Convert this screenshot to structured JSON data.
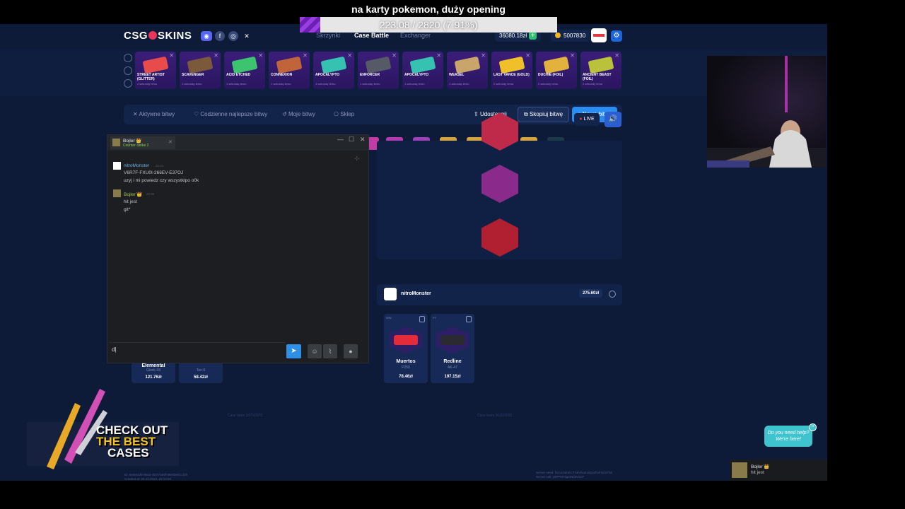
{
  "overlay": {
    "title": "na karty pokemon, duży opening",
    "progress_text": "223.08 / 2820 (7.91%)",
    "progress_fraction": 0.0791
  },
  "header": {
    "logo": "CSG⬤SKINS",
    "nav": [
      "Skrzynki",
      "Case Battle",
      "Exchanger"
    ],
    "balance": "36080.18zł",
    "coins": "5007830"
  },
  "drops": [
    {
      "name": "STREET ARTIST (GLITTER)",
      "sub": "2 sekundy temu",
      "color": "#e84b4b"
    },
    {
      "name": "SCAVENGER",
      "sub": "1 sekundę temu",
      "color": "#7a5a3a"
    },
    {
      "name": "ACID ETCHED",
      "sub": "1 sekundę temu",
      "color": "#3dc46e"
    },
    {
      "name": "CONNEXION",
      "sub": "1 sekundę temu",
      "color": "#c0653a"
    },
    {
      "name": "APOCALYPTO",
      "sub": "1 sekundę temu",
      "color": "#35c2b0"
    },
    {
      "name": "ENFORCER",
      "sub": "1 sekundę temu",
      "color": "#555a66"
    },
    {
      "name": "APOCALYPTO",
      "sub": "1 sekundę temu",
      "color": "#35c2b0"
    },
    {
      "name": "WEASEL",
      "sub": "1 sekundę temu",
      "color": "#c9a56b"
    },
    {
      "name": "LAST VANCE (GOLD)",
      "sub": "2 sekundy temu",
      "color": "#f0c028"
    },
    {
      "name": "DUCHIE (FOIL)",
      "sub": "2 sekundy temu",
      "color": "#e3b23c"
    },
    {
      "name": "ANCIENT BEAST (FOIL)",
      "sub": "2 sekundy temu",
      "color": "#b9c23a"
    }
  ],
  "toolbar": {
    "tabs": [
      "Aktywne bitwy",
      "Codzienne najlepsze bitwy",
      "Moje bitwy",
      "Sklep"
    ],
    "share": "Udostępnij",
    "copy": "Skopiuj bitwę",
    "new": "Nowa bitwa"
  },
  "battle": {
    "live": "LIVE",
    "player_name": "nitroMonster",
    "player_value": "275.60zł",
    "items": [
      {
        "wear": "WW",
        "name": "Muertos",
        "sub": "P250",
        "price": "78.46zł",
        "color": "#e32b3a"
      },
      {
        "wear": "FT",
        "name": "Redline",
        "sub": "AK-47",
        "price": "197.15zł",
        "color": "#2a2a30"
      }
    ],
    "left_items": [
      {
        "name": "Elemental",
        "sub": "Glock-18",
        "price": "121.76zł"
      },
      {
        "name": "",
        "sub": "Tec-9",
        "price": "58.42zł"
      }
    ],
    "footer_left": "Case team 2970/2970",
    "footer_right": "Case team 3025/3026",
    "id_line1": "ID: 6e6e01f6-9ea3-4974-be9f-86e5be0cc1f9",
    "id_line2": "Created at: 26.12.2024, 22:13:59",
    "seed_line1": "Server seed: hsCezamKCTS6VNuInwQs2hvF3SSYkb",
    "seed_line2": "Secret salt: y9PFNF4qmNOtVSAT"
  },
  "chat": {
    "tab_name": "Bojler 👑",
    "tab_game": "Counter-Strike 2",
    "messages": [
      {
        "name": "nitroMonster",
        "time": "22:21",
        "lines": [
          "V6R7F-FXU0I-266EV-E37OJ",
          "uzyj i mi powiedz czy wszystklpo o0k"
        ]
      },
      {
        "name": "Bojler 👑",
        "time": "22:36",
        "lines": [
          "hit jest",
          "git*"
        ]
      }
    ],
    "input_value": "d|"
  },
  "promo": {
    "line1": "CHECK OUT",
    "line2": "THE BEST",
    "line3": "CASES"
  },
  "help": {
    "text": "Do you need help? We're here!"
  },
  "feed": {
    "name": "Bojler 👑",
    "message": "hit jest"
  }
}
